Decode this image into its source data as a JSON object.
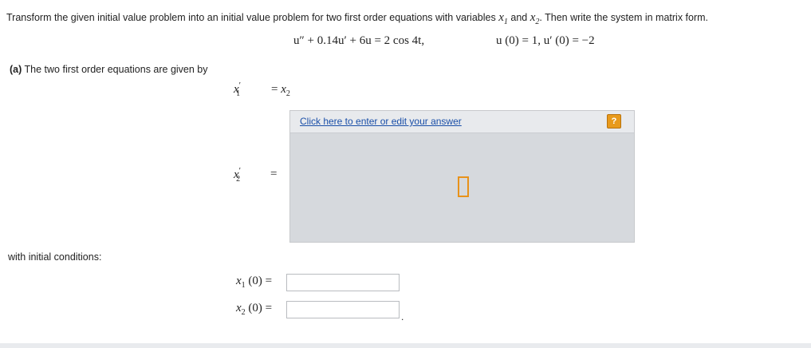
{
  "problem": {
    "intro_text": "Transform the given initial value problem into an initial value problem for two first order equations with variables",
    "var1": "x",
    "var1_sub": "1",
    "and_text": "and",
    "var2": "x",
    "var2_sub": "2",
    "tail_text": ". Then write the system in matrix form.",
    "ode": "u″ + 0.14u′ + 6u = 2 cos  4t,",
    "initial_conditions": "u (0)  = 1,  u′ (0) = −2"
  },
  "part_a": {
    "label": "(a)",
    "text": "The two first order equations are given by",
    "eq1_lhs": "x",
    "eq1_lhs_prime": "′",
    "eq1_lhs_sub": "1",
    "eq1_rhs": "=",
    "eq1_rhs_var": "x",
    "eq1_rhs_sub": "2",
    "eq2_lhs": "x",
    "eq2_lhs_prime": "′",
    "eq2_lhs_sub": "2",
    "eq2_eq": "="
  },
  "answer_box": {
    "link_text": "Click here to enter or edit your answer",
    "help_label": "?",
    "help_icon": "question-icon"
  },
  "initial_conditions_section": {
    "label": "with initial conditions:",
    "x1_lhs": "x",
    "x1_sub": "1",
    "x1_arg": "(0)",
    "x1_eq": "=",
    "x1_value": "",
    "x2_lhs": "x",
    "x2_sub": "2",
    "x2_arg": "(0)",
    "x2_eq": "=",
    "x2_value": "",
    "trailing": "."
  },
  "colors": {
    "link": "#1a4fa8",
    "help_icon": "#e89a1c",
    "answer_panel": "#d6d9dd",
    "cursor_box": "#e8921a"
  }
}
